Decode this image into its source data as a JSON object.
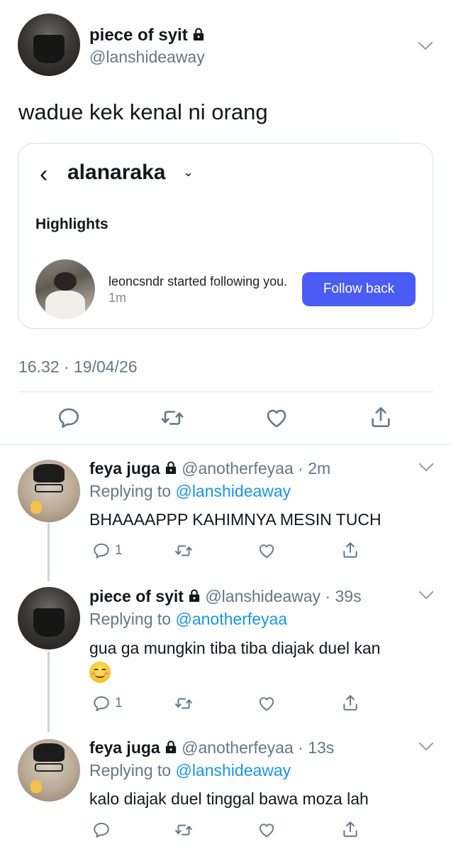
{
  "main_tweet": {
    "name": "piece of syit",
    "handle": "@lanshideaway",
    "text": "wadue kek kenal ni orang",
    "timestamp": "16.32 · 19/04/26"
  },
  "embed": {
    "back_glyph": "‹",
    "username": "alanaraka",
    "dropdown_glyph": "⌄",
    "highlights_label": "Highlights",
    "notification_user": "leoncsndr",
    "notification_text": "started following you.",
    "notification_time": "1m",
    "follow_back_label": "Follow back"
  },
  "replies": [
    {
      "name": "feya juga",
      "handle": "@anotherfeyaa",
      "time": "2m",
      "replying_prefix": "Replying to",
      "replying_to": "@lanshideaway",
      "text": "BHAAAAPPP KAHIMNYA MESIN TUCH",
      "reply_count": "1"
    },
    {
      "name": "piece of syit",
      "handle": "@lanshideaway",
      "time": "39s",
      "replying_prefix": "Replying to",
      "replying_to": "@anotherfeyaa",
      "text": "gua ga mungkin tiba tiba diajak duel kan",
      "reply_count": "1"
    },
    {
      "name": "feya juga",
      "handle": "@anotherfeyaa",
      "time": "13s",
      "replying_prefix": "Replying to",
      "replying_to": "@lanshideaway",
      "text": "kalo diajak duel tinggal bawa moza lah",
      "reply_count": ""
    }
  ],
  "icons": {
    "reply": "reply-icon",
    "retweet": "retweet-icon",
    "like": "heart-icon",
    "share": "share-icon",
    "lock": "lock-icon",
    "chevron": "chevron-down-icon"
  },
  "colors": {
    "link": "#1b95e0",
    "follow_button": "#4b5cf5",
    "muted": "#657786"
  }
}
